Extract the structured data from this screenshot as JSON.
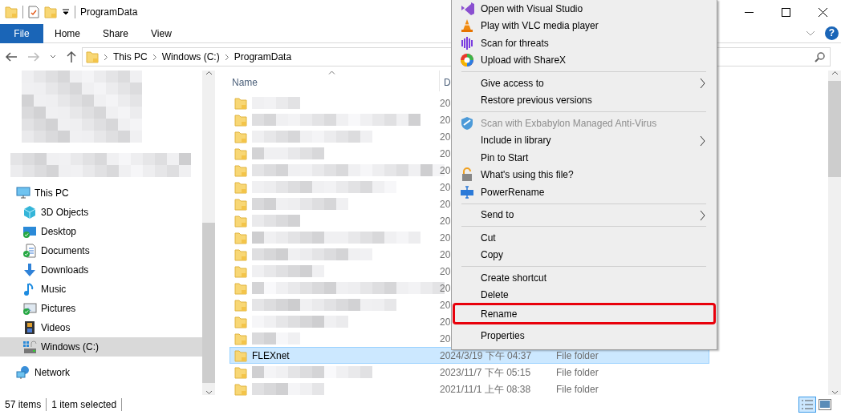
{
  "window": {
    "title": "ProgramData"
  },
  "ribbon": {
    "tabs": [
      {
        "label": "File",
        "kind": "menu"
      },
      {
        "label": "Home",
        "kind": "tab"
      },
      {
        "label": "Share",
        "kind": "tab"
      },
      {
        "label": "View",
        "kind": "tab"
      }
    ],
    "help": "?"
  },
  "address_bar": {
    "path": [
      "This PC",
      "Windows (C:)",
      "ProgramData"
    ]
  },
  "navigation": [
    {
      "label": "This PC",
      "kind": "computer",
      "selected": false,
      "children": [
        {
          "label": "3D Objects",
          "kind": "objects",
          "selected": false
        },
        {
          "label": "Desktop",
          "kind": "desktop",
          "selected": false
        },
        {
          "label": "Documents",
          "kind": "documents",
          "selected": false
        },
        {
          "label": "Downloads",
          "kind": "downloads",
          "selected": false
        },
        {
          "label": "Music",
          "kind": "music",
          "selected": false
        },
        {
          "label": "Pictures",
          "kind": "pictures",
          "selected": false
        },
        {
          "label": "Videos",
          "kind": "videos",
          "selected": false
        },
        {
          "label": "Windows (C:)",
          "kind": "drive",
          "selected": true
        }
      ]
    },
    {
      "label": "Network",
      "kind": "network",
      "selected": false
    }
  ],
  "file_list": {
    "columns": [
      {
        "label": "Name",
        "sorted": true
      },
      {
        "label": "D"
      }
    ],
    "rows": [
      {
        "date": "20",
        "selected": false
      },
      {
        "date": "20",
        "selected": false
      },
      {
        "date": "20",
        "selected": false
      },
      {
        "date": "20",
        "selected": false
      },
      {
        "date": "20",
        "selected": false
      },
      {
        "date": "20",
        "selected": false
      },
      {
        "date": "20",
        "selected": false
      },
      {
        "date": "20",
        "selected": false
      },
      {
        "date": "20",
        "selected": false
      },
      {
        "date": "20",
        "selected": false
      },
      {
        "date": "20",
        "selected": false
      },
      {
        "date": "20",
        "selected": false
      },
      {
        "date": "20",
        "selected": false
      },
      {
        "date": "20",
        "selected": false
      },
      {
        "date": "20",
        "selected": false
      },
      {
        "name": "FLEXnet",
        "date": "2024/3/19 下午 04:37",
        "type": "File folder",
        "selected": true
      },
      {
        "date": "2023/11/7 下午 05:15",
        "type": "File folder",
        "selected": false
      },
      {
        "date": "2021/11/1 上午 08:38",
        "type": "File folder",
        "selected": false
      }
    ]
  },
  "context_menu": {
    "items": [
      {
        "kind": "item",
        "label": "Open with Visual Studio",
        "disabled": false,
        "submenu": false,
        "highlighted": false
      },
      {
        "kind": "item",
        "label": "Play with VLC media player",
        "disabled": false,
        "submenu": false,
        "highlighted": false
      },
      {
        "kind": "item",
        "label": "Scan for threats",
        "disabled": false,
        "submenu": false,
        "highlighted": false
      },
      {
        "kind": "item",
        "label": "Upload with ShareX",
        "disabled": false,
        "submenu": false,
        "highlighted": false
      },
      {
        "kind": "separator"
      },
      {
        "kind": "item",
        "label": "Give access to",
        "disabled": false,
        "submenu": true,
        "highlighted": false
      },
      {
        "kind": "item",
        "label": "Restore previous versions",
        "disabled": false,
        "submenu": false,
        "highlighted": false
      },
      {
        "kind": "separator"
      },
      {
        "kind": "item",
        "label": "Scan with Exbabylon Managed Anti-Virus",
        "disabled": true,
        "submenu": false,
        "highlighted": false
      },
      {
        "kind": "item",
        "label": "Include in library",
        "disabled": false,
        "submenu": true,
        "highlighted": false
      },
      {
        "kind": "item",
        "label": "Pin to Start",
        "disabled": false,
        "submenu": false,
        "highlighted": false
      },
      {
        "kind": "item",
        "label": "What's using this file?",
        "disabled": false,
        "submenu": false,
        "highlighted": false
      },
      {
        "kind": "item",
        "label": "PowerRename",
        "disabled": false,
        "submenu": false,
        "highlighted": false
      },
      {
        "kind": "separator"
      },
      {
        "kind": "item",
        "label": "Send to",
        "disabled": false,
        "submenu": true,
        "highlighted": false
      },
      {
        "kind": "separator"
      },
      {
        "kind": "item",
        "label": "Cut",
        "disabled": false,
        "submenu": false,
        "highlighted": false
      },
      {
        "kind": "item",
        "label": "Copy",
        "disabled": false,
        "submenu": false,
        "highlighted": false
      },
      {
        "kind": "separator"
      },
      {
        "kind": "item",
        "label": "Create shortcut",
        "disabled": false,
        "submenu": false,
        "highlighted": false
      },
      {
        "kind": "item",
        "label": "Delete",
        "disabled": false,
        "submenu": false,
        "highlighted": false
      },
      {
        "kind": "item",
        "label": "Rename",
        "disabled": false,
        "submenu": false,
        "highlighted": true
      },
      {
        "kind": "gap"
      },
      {
        "kind": "item",
        "label": "Properties",
        "disabled": false,
        "submenu": false,
        "highlighted": false
      }
    ]
  },
  "status_bar": {
    "item_count": "57 items",
    "selection": "1 item selected"
  }
}
